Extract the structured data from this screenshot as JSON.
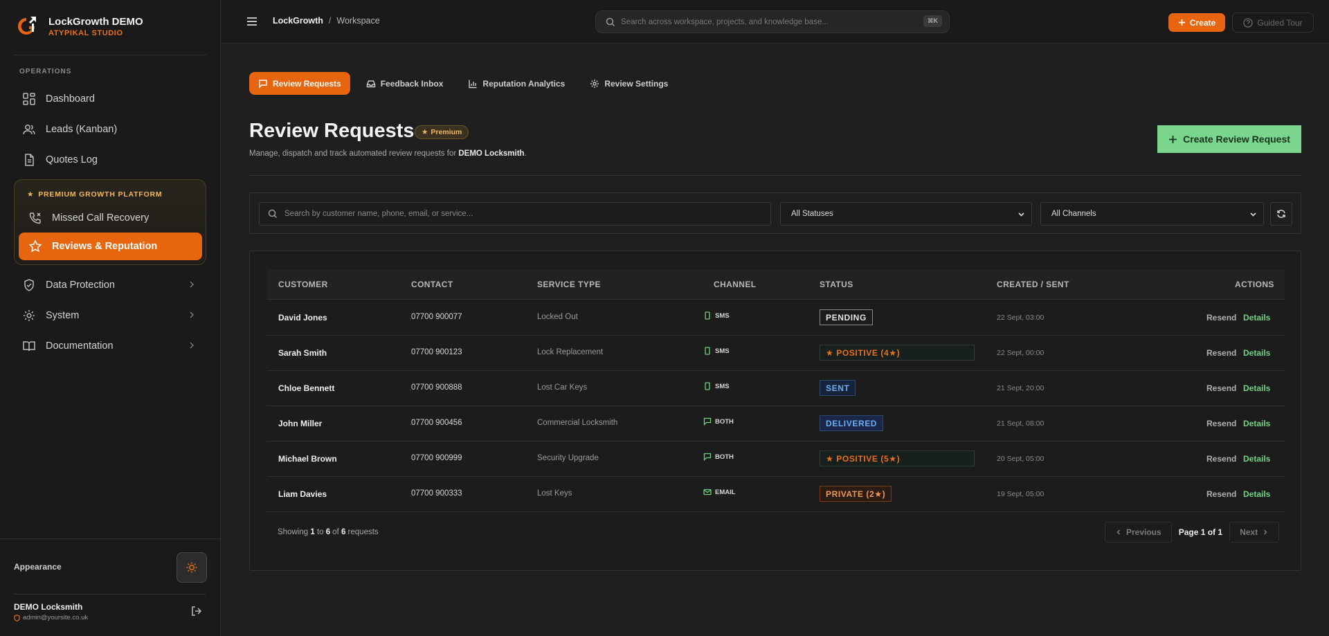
{
  "brand": {
    "name": "LockGrowth DEMO",
    "sub": "ATYPIKAL STUDIO"
  },
  "sidebar": {
    "section": "OPERATIONS",
    "items": [
      {
        "label": "Dashboard"
      },
      {
        "label": "Leads (Kanban)"
      },
      {
        "label": "Quotes Log"
      }
    ],
    "premium": {
      "title": "PREMIUM GROWTH PLATFORM",
      "items": [
        {
          "label": "Missed Call Recovery"
        },
        {
          "label": "Reviews & Reputation"
        }
      ]
    },
    "lower_items": [
      {
        "label": "Data Protection"
      },
      {
        "label": "System"
      },
      {
        "label": "Documentation"
      }
    ],
    "appearance": "Appearance",
    "user": {
      "name": "DEMO Locksmith",
      "email": "admin@yoursite.co.uk"
    }
  },
  "topbar": {
    "crumb1": "LockGrowth",
    "sep": "/",
    "crumb2": "Workspace",
    "search_placeholder": "Search across workspace, projects, and knowledge base...",
    "shortcut": "⌘K",
    "create": "Create",
    "tour": "Guided Tour"
  },
  "tabs": [
    {
      "label": "Review Requests"
    },
    {
      "label": "Feedback Inbox"
    },
    {
      "label": "Reputation Analytics"
    },
    {
      "label": "Review Settings"
    }
  ],
  "page": {
    "title": "Review Requests",
    "badge": "Premium",
    "desc_prefix": "Manage, dispatch and track automated review requests for ",
    "desc_bold": "DEMO Locksmith",
    "desc_suffix": ".",
    "create_button": "Create Review Request"
  },
  "filters": {
    "search_placeholder": "Search by customer name, phone, email, or service...",
    "status": "All Statuses",
    "channel": "All Channels"
  },
  "table": {
    "headers": [
      "CUSTOMER",
      "CONTACT",
      "SERVICE TYPE",
      "CHANNEL",
      "STATUS",
      "CREATED / SENT",
      "ACTIONS"
    ],
    "rows": [
      {
        "customer": "David Jones",
        "contact": "07700 900077",
        "service": "Locked Out",
        "channel": "SMS",
        "status": "PENDING",
        "date": "22 Sept, 03:00"
      },
      {
        "customer": "Sarah Smith",
        "contact": "07700 900123",
        "service": "Lock Replacement",
        "channel": "SMS",
        "status": "★ POSITIVE (4★)",
        "date": "22 Sept, 00:00"
      },
      {
        "customer": "Chloe Bennett",
        "contact": "07700 900888",
        "service": "Lost Car Keys",
        "channel": "SMS",
        "status": "SENT",
        "date": "21 Sept, 20:00"
      },
      {
        "customer": "John Miller",
        "contact": "07700 900456",
        "service": "Commercial Locksmith",
        "channel": "BOTH",
        "status": "DELIVERED",
        "date": "21 Sept, 08:00"
      },
      {
        "customer": "Michael Brown",
        "contact": "07700 900999",
        "service": "Security Upgrade",
        "channel": "BOTH",
        "status": "★ POSITIVE (5★)",
        "date": "20 Sept, 05:00"
      },
      {
        "customer": "Liam Davies",
        "contact": "07700 900333",
        "service": "Lost Keys",
        "channel": "EMAIL",
        "status": "PRIVATE (2★)",
        "date": "19 Sept, 05:00"
      }
    ],
    "resend": "Resend",
    "details": "Details"
  },
  "pagination": {
    "showing": "Showing",
    "from": "1",
    "to_word": "to",
    "to": "6",
    "of_word": "of",
    "total": "6",
    "suffix": "requests",
    "previous": "Previous",
    "page_info": "Page 1 of 1",
    "next": "Next"
  },
  "colors": {
    "accent": "#e8650f",
    "success": "#7ad68c",
    "info": "#6aaef5"
  }
}
